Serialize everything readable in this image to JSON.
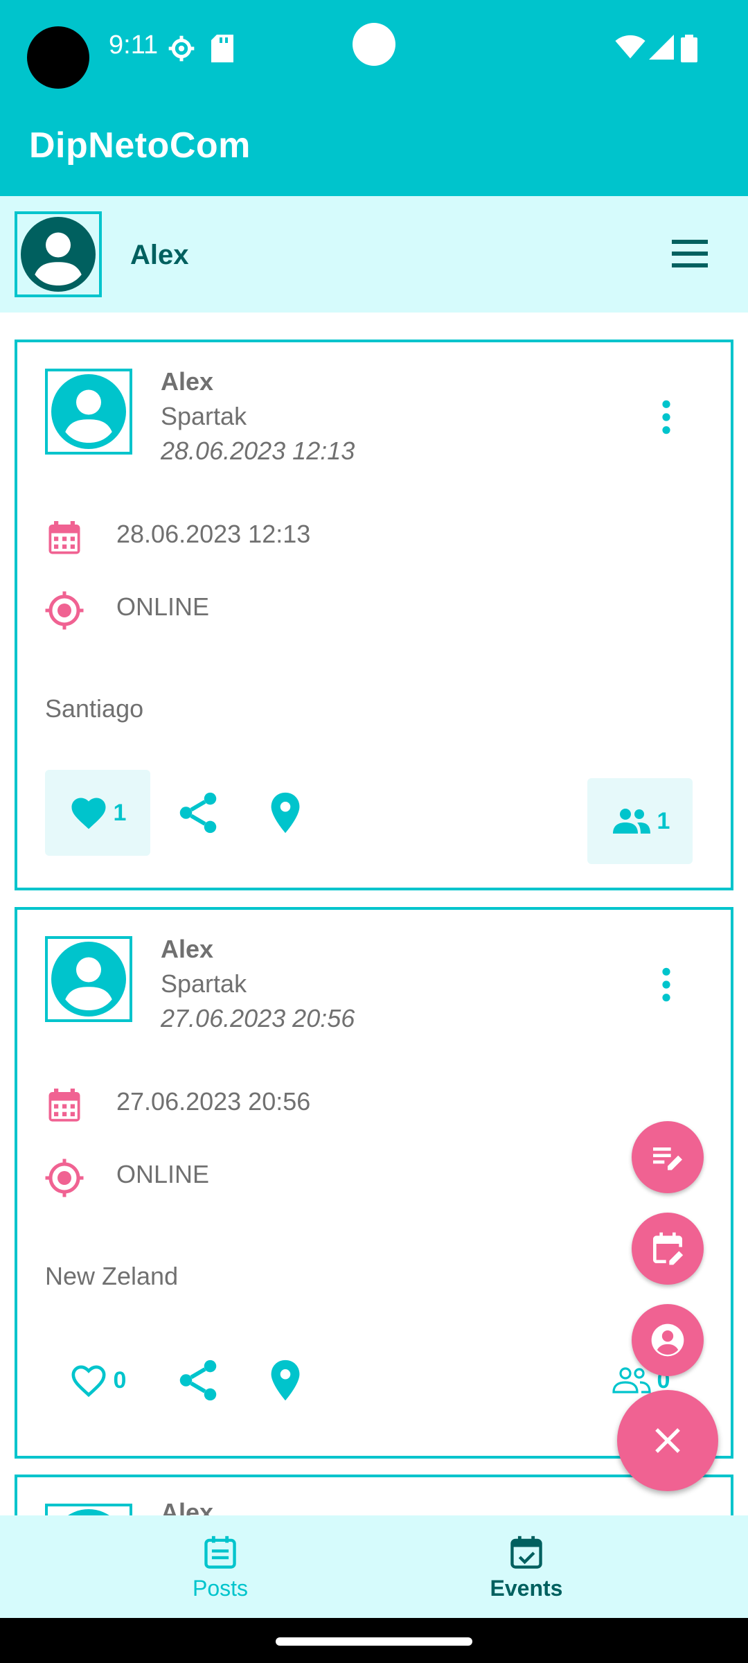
{
  "status": {
    "time": "9:11"
  },
  "app": {
    "title": "DipNetoCom"
  },
  "user": {
    "name": "Alex"
  },
  "cards": [
    {
      "author": "Alex",
      "subtitle": "Spartak",
      "published": "28.06.2023 12:13",
      "event_datetime": "28.06.2023 12:13",
      "event_type": "ONLINE",
      "content": "Santiago",
      "likes": "1",
      "participants": "1"
    },
    {
      "author": "Alex",
      "subtitle": "Spartak",
      "published": "27.06.2023 20:56",
      "event_datetime": "27.06.2023 20:56",
      "event_type": "ONLINE",
      "content": "New Zeland",
      "likes": "0",
      "participants": "0"
    },
    {
      "author": "Alex"
    }
  ],
  "nav": {
    "posts": "Posts",
    "events": "Events"
  },
  "colors": {
    "primary": "#00c4cc",
    "primary_dark": "#00605f",
    "accent": "#f06292",
    "surface_light": "#d6fbfc"
  }
}
